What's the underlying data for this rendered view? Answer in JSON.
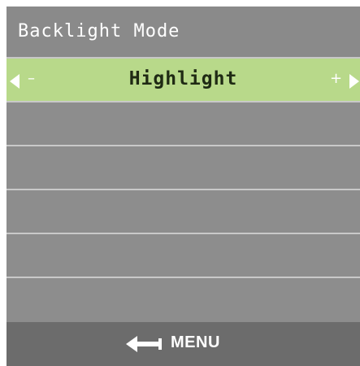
{
  "title": "Backlight Mode",
  "setting": {
    "value": "Highlight",
    "decrement_glyph": "–",
    "increment_glyph": "+"
  },
  "footer": {
    "menu_label": "MENU",
    "back_icon": "back-arrow-icon"
  },
  "colors": {
    "background": "#8c8c8c",
    "selected_row": "#b8d98a",
    "footer": "#6c6c6c",
    "divider": "#c9c9c9",
    "text": "#ffffff"
  }
}
